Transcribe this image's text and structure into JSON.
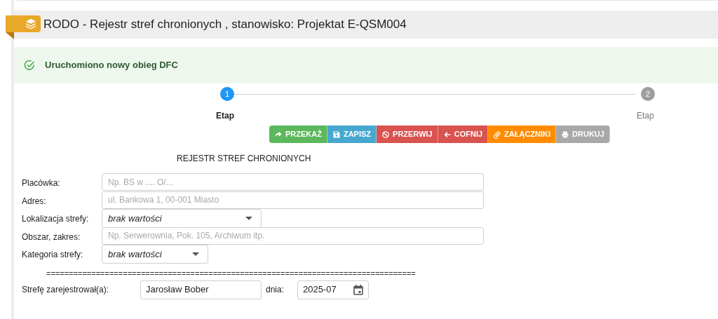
{
  "header": {
    "title": "RODO - Rejestr stref chronionych , stanowisko: Projektat E-QSM004"
  },
  "alert": {
    "message": "Uruchomiono nowy obieg DFC"
  },
  "steps": [
    {
      "number": "1",
      "label": "Etap",
      "selected": true
    },
    {
      "number": "2",
      "label": "Etap",
      "selected": false
    }
  ],
  "buttons": [
    {
      "label": "PRZEKAŻ",
      "kind": "forward",
      "disabled": false
    },
    {
      "label": "ZAPISZ",
      "kind": "save",
      "disabled": false
    },
    {
      "label": "PRZERWIJ",
      "kind": "stop",
      "disabled": false
    },
    {
      "label": "COFNIJ",
      "kind": "back",
      "disabled": false
    },
    {
      "label": "ZAŁĄCZNIKI",
      "kind": "attach",
      "disabled": false
    },
    {
      "label": "DRUKUJ",
      "kind": "print",
      "disabled": true
    }
  ],
  "form": {
    "title": "REJESTR STREF CHRONIONYCH",
    "fields": [
      {
        "label": "Placówka:",
        "kind": "text",
        "placeholder": "Np. BS w .... O/..."
      },
      {
        "label": "Adres:",
        "kind": "text",
        "placeholder": "ul. Bankowa 1, 00-001 Miasto"
      },
      {
        "label": "Lokalizacja strefy:",
        "kind": "select",
        "value": "brak wartości"
      },
      {
        "label": "Obszar, zakres:",
        "kind": "text",
        "placeholder": "Np. Serwerownia, Pok. 105, Archiwum itp."
      },
      {
        "label": "Kategoria strefy:",
        "kind": "select",
        "value": "brak wartości"
      }
    ],
    "separator": "==================================================================================",
    "registrant": {
      "label": "Strefę zarejestrował(a):",
      "value": "Jarosław Bober",
      "date_label": "dnia:",
      "date_value": "2025-07"
    }
  }
}
